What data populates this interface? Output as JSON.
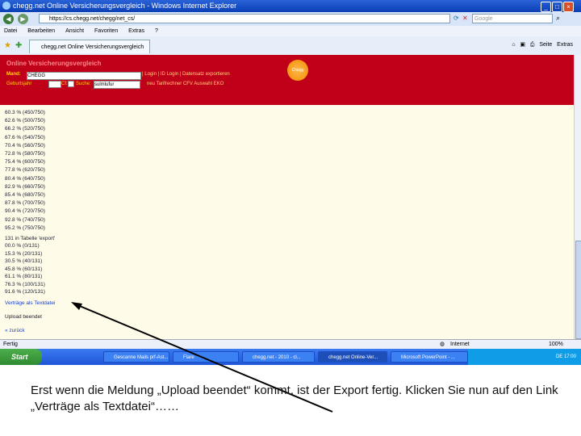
{
  "window": {
    "title": "chegg.net Online Versicherungsvergleich - Windows Internet Explorer",
    "address": "https://cs.chegg.net/chegg/net_cs/",
    "search_placeholder": "Google"
  },
  "menu": [
    "Datei",
    "Bearbeiten",
    "Ansicht",
    "Favoriten",
    "Extras",
    "?"
  ],
  "tab": {
    "label": "chegg.net Online Versicherungsvergleich"
  },
  "toolbar": {
    "page": "Seite",
    "extras": "Extras"
  },
  "header": {
    "title": "Online Versicherungsvergleich",
    "mand_label": "Mand:",
    "mand_value": "CHEGG",
    "links1": "| Login | ID Login | Datensatz exportieren",
    "geburtsjahr_label": "Geburtsjahr",
    "cf_label": "Cf:",
    "suche_label": "Suche:",
    "suche_value": "sulmlufur",
    "links2": "neu Tarifrechner CFV Auswahl EKO",
    "logo_text": "Chegg"
  },
  "content": {
    "list1": [
      "60.3 %   (450/750)",
      "62.6 %   (500/750)",
      "66.2 %   (520/750)",
      "67.6 %   (540/750)",
      "70.4 %   (560/750)",
      "72.8 %   (580/750)",
      "75.4 %   (600/750)",
      "77.8 %   (620/750)",
      "80.4 %   (640/750)",
      "82.9 %   (660/750)",
      "85.4 %   (680/750)",
      "87.8 %   (700/750)",
      "90.4 %   (720/750)",
      "92.8 %   (740/750)",
      "95.2 %   (750/750)"
    ],
    "section2_title": "131 in Tabelle 'export'",
    "list2": [
      "00.0 %   (0/131)",
      "15.3 %   (20/131)",
      "30.5 %   (40/131)",
      "45.8 %   (60/131)",
      "61.1 %   (80/131)",
      "76.3 %   (100/131)",
      "91.6 %   (120/131)"
    ],
    "link_vertraege": "Verträge als Textdatei",
    "upload_status": "Upload beendet",
    "back_link": "« zurück"
  },
  "status": {
    "left": "Fertig",
    "zone": "Internet",
    "zoom": "100%"
  },
  "taskbar": {
    "start": "Start",
    "tasks": [
      "Gescanne Mails prf-Ast...",
      "Flare",
      "chegg.net - 2010 - cl...",
      "chegg.net Online-Ver...",
      "Microsoft PowerPoint - ..."
    ],
    "tray": "DE  17:00"
  },
  "caption": "Erst wenn die Meldung „Upload beendet“ kommt, ist der Export fertig. Klicken Sie nun auf den Link „Verträge als Textdatei“……",
  "colors": {
    "header_red": "#c00018",
    "content_bg": "#fefbe8",
    "link_blue": "#1a3fc0",
    "taskbar_blue": "#1f56d8"
  }
}
